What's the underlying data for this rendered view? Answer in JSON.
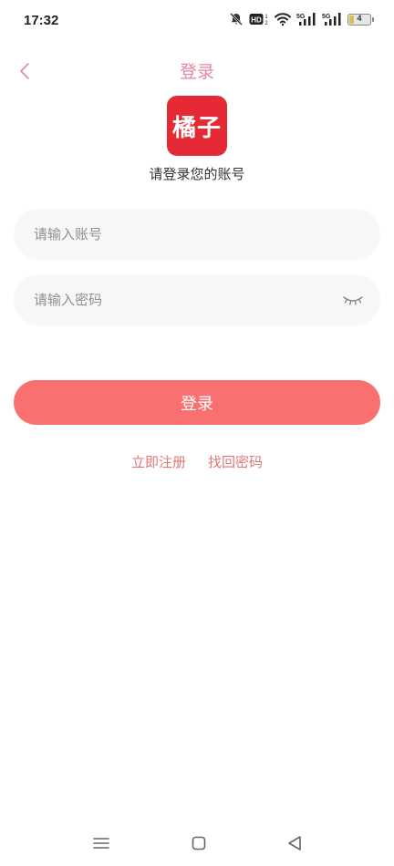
{
  "status_bar": {
    "time": "17:32",
    "network_label": "5G",
    "battery_level": "4",
    "icons": [
      "bell-off-icon",
      "hd-icon",
      "wifi-icon",
      "signal-5g-icon",
      "signal-5g-icon",
      "battery-icon"
    ]
  },
  "header": {
    "title": "登录",
    "back_icon": "chevron-left-icon"
  },
  "logo": {
    "text": "橘子",
    "background_color": "#e52a36"
  },
  "subtitle": "请登录您的账号",
  "form": {
    "account_placeholder": "请输入账号",
    "account_value": "",
    "password_placeholder": "请输入密码",
    "password_value": "",
    "password_toggle_icon": "eye-closed-icon"
  },
  "login_button": {
    "label": "登录",
    "color": "#f97070"
  },
  "links": {
    "register": "立即注册",
    "forgot_password": "找回密码"
  },
  "nav_bar": {
    "icons": [
      "menu-icon",
      "home-square-icon",
      "back-triangle-icon"
    ]
  },
  "colors": {
    "accent": "#e7869b",
    "link": "#e07677",
    "input_bg": "#f7f7f8"
  }
}
